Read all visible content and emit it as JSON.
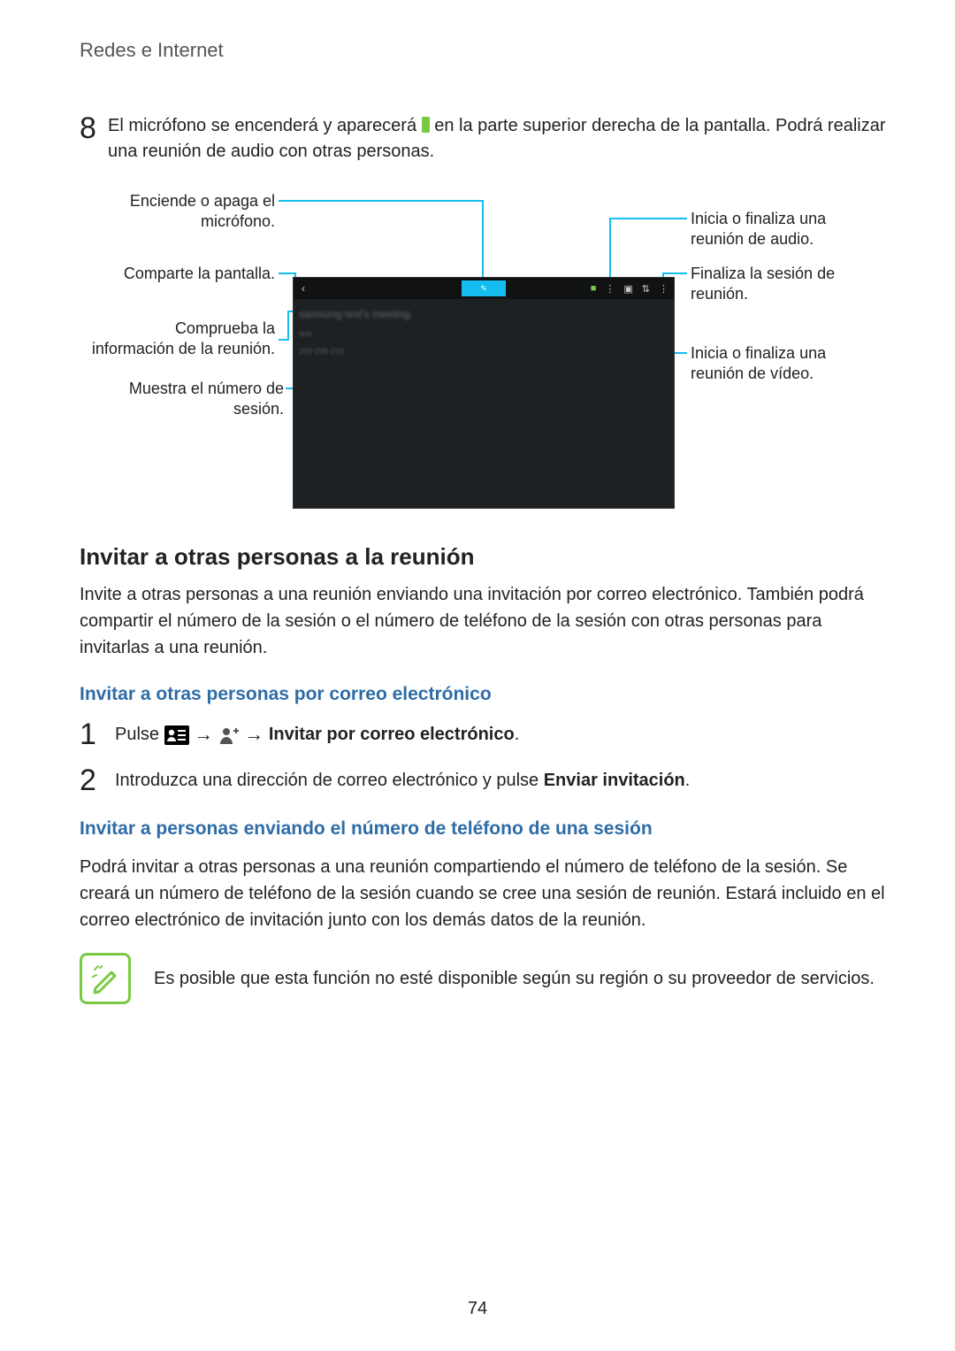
{
  "header": {
    "title": "Redes e Internet"
  },
  "step8": {
    "num": "8",
    "part_a": "El micrófono se encenderá y aparecerá ",
    "part_b": " en la parte superior derecha de la pantalla. Podrá realizar una reunión de audio con otras personas."
  },
  "callouts": {
    "left": [
      "Enciende o apaga el micrófono.",
      "Comparte la pantalla.",
      "Comprueba la información de la reunión.",
      "Muestra el número de sesión."
    ],
    "right": [
      "Inicia o finaliza una reunión de audio.",
      "Finaliza la sesión de reunión.",
      "Inicia o finaliza una reunión de vídeo."
    ]
  },
  "screenshot": {
    "back_glyph": "‹",
    "center_glyph": "✎",
    "bar_right": [
      "■",
      "⋮",
      "▣",
      "⇅",
      "⋮"
    ],
    "panel_line1": "samsung test's meeting",
    "panel_line2": "test",
    "panel_line3": "200-295-219"
  },
  "section": {
    "title": "Invitar a otras personas a la reunión",
    "intro": "Invite a otras personas a una reunión enviando una invitación por correo electrónico. También podrá compartir el número de la sesión o el número de teléfono de la sesión con otras personas para invitarlas a una reunión."
  },
  "sub1": {
    "title": "Invitar a otras personas por correo electrónico",
    "step1_pref": "Pulse ",
    "arrow": "→",
    "step1_bold": "Invitar por correo electrónico",
    "step1_num": "1",
    "step2_num": "2",
    "step2_a": "Introduzca una dirección de correo electrónico y pulse ",
    "step2_bold": "Enviar invitación",
    "period": "."
  },
  "sub2": {
    "title": "Invitar a personas enviando el número de teléfono de una sesión",
    "para": "Podrá invitar a otras personas a una reunión compartiendo el número de teléfono de la sesión. Se creará un número de teléfono de la sesión cuando se cree una sesión de reunión. Estará incluido en el correo electrónico de invitación junto con los demás datos de la reunión."
  },
  "note": {
    "text": "Es posible que esta función no esté disponible según su región o su proveedor de servicios."
  },
  "page_number": "74"
}
